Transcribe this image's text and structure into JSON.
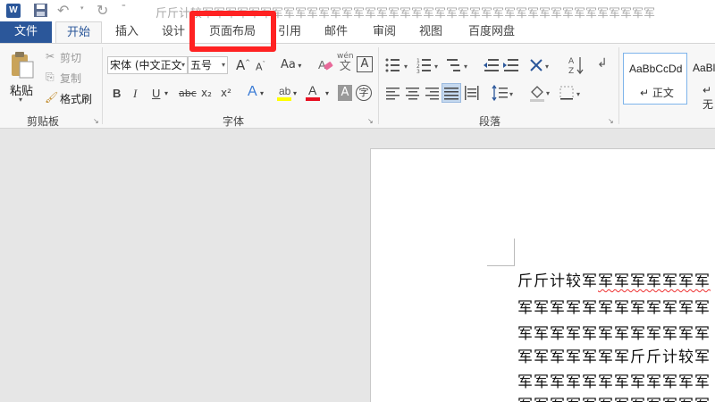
{
  "titlebar": {
    "app_icon_letter": "W",
    "title": "斤斤计较军军军军军军军军军军军军军军军军军军军军军军军军军军军军军军军军军军军军军军军"
  },
  "tabs": [
    {
      "label": "文件"
    },
    {
      "label": "开始"
    },
    {
      "label": "插入"
    },
    {
      "label": "设计"
    },
    {
      "label": "页面布局"
    },
    {
      "label": "引用"
    },
    {
      "label": "邮件"
    },
    {
      "label": "审阅"
    },
    {
      "label": "视图"
    },
    {
      "label": "百度网盘"
    }
  ],
  "clipboard": {
    "paste_label": "粘贴",
    "cut_label": "剪切",
    "copy_label": "复制",
    "format_painter_label": "格式刷",
    "group_label": "剪贴板"
  },
  "font": {
    "font_name": "宋体 (中文正文",
    "font_size": "五号",
    "group_label": "字体",
    "grow_label": "A",
    "shrink_label": "A",
    "case_label": "Aa",
    "pinyin_label": "wén",
    "pinyin_char": "文",
    "border_char": "A",
    "bold": "B",
    "italic": "I",
    "underline": "U",
    "strike": "abc",
    "subscript": "x₂",
    "superscript": "x²",
    "effect": "A",
    "font_color": "A",
    "shade_char": "A",
    "enclose_char": "字"
  },
  "paragraph": {
    "group_label": "段落"
  },
  "styles": {
    "items": [
      {
        "sample": "AaBbCcDd",
        "name": "↵ 正文"
      },
      {
        "sample": "AaBl",
        "name": "↵ 无"
      }
    ]
  },
  "document": {
    "lines": [
      {
        "plain": "斤斤计较军",
        "marked": "军军军军军军军"
      },
      {
        "plain": "军军军军军军军军军军军军",
        "marked": ""
      },
      {
        "plain": "军军军军军军军军军军军军",
        "marked": ""
      },
      {
        "plain": "军军军军军军军斤斤计较军",
        "marked": ""
      },
      {
        "plain": "军军军军军军军军军军军军",
        "marked": ""
      },
      {
        "plain": "军军军军军军军军军军军军",
        "marked": ""
      }
    ]
  },
  "colors": {
    "accent": "#2b579a",
    "highlight_box": "#ff2222",
    "font_color_bar": "#e81123",
    "highlight_bar": "#ffff00"
  }
}
